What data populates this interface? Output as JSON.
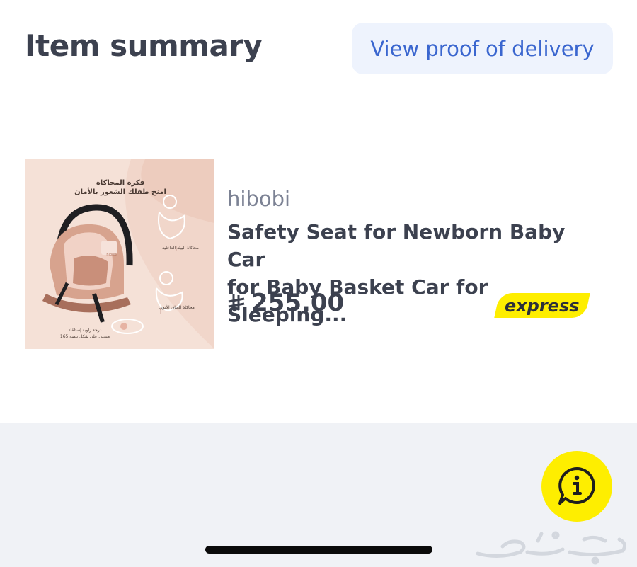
{
  "header": {
    "title": "Item summary",
    "proof_button_label": "View proof of delivery"
  },
  "item": {
    "brand": "hibobi",
    "name_line1": "Safety Seat for Newborn Baby Car",
    "name_line2": "for Baby Basket Car for Sleeping...",
    "price": "255.00",
    "currency_icon": "saudi-riyal-icon",
    "badge": "express",
    "image": {
      "headline_line1": "فكرة المحاكاة",
      "headline_line2": "امنح طفلك الشعور بالأمان",
      "label_1": "محاكاة البيئة الداخلية",
      "label_2": "محاكاة العناق الأبوي",
      "label_3_line1": "درجة زاوية إستلقاء",
      "label_3_line2": "منحنى على شكل بيضة 165",
      "seat_brand": "hibobi"
    }
  },
  "fab": {
    "icon": "info-icon"
  },
  "watermark": {
    "icon": "haraj-logo"
  },
  "colors": {
    "title": "#3c414f",
    "accent_blue": "#3a66cf",
    "button_bg": "#eef3fd",
    "express_yellow": "#feee00",
    "muted": "#7c8294",
    "bottom_bg": "#f0f2f6"
  }
}
